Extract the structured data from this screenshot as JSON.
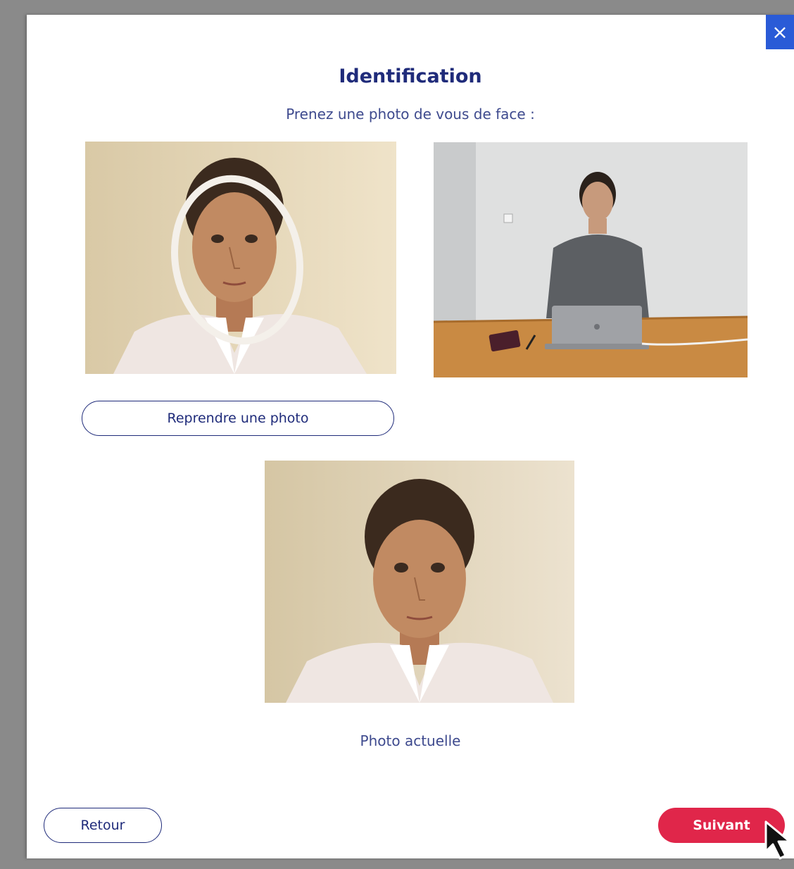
{
  "modal": {
    "title": "Identification",
    "subtitle": "Prenez une photo de vous de face :",
    "close_label": "×"
  },
  "actions": {
    "retake_label": "Reprendre une photo",
    "back_label": "Retour",
    "next_label": "Suivant"
  },
  "current_photo": {
    "caption": "Photo actuelle"
  },
  "icons": {
    "close": "close-icon",
    "cursor": "mouse-pointer-icon"
  },
  "colors": {
    "title": "#1f2b7a",
    "accent_red": "#e0264a",
    "close_bg": "#2a5bd7"
  }
}
